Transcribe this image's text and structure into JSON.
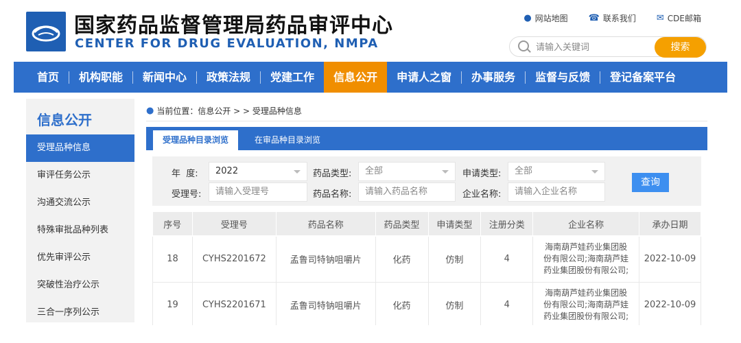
{
  "header": {
    "title_cn": "国家药品监督管理局药品审评中心",
    "title_en": "CENTER FOR DRUG EVALUATION, NMPA",
    "links": [
      {
        "icon": "location-icon",
        "label": "网站地图"
      },
      {
        "icon": "phone-icon",
        "label": "联系我们"
      },
      {
        "icon": "mail-icon",
        "label": "CDE邮箱"
      }
    ],
    "search_placeholder": "请输入关键词",
    "search_button": "搜索"
  },
  "nav": [
    "首页",
    "机构职能",
    "新闻中心",
    "政策法规",
    "党建工作",
    "信息公开",
    "申请人之窗",
    "办事服务",
    "监督与反馈",
    "登记备案平台"
  ],
  "nav_active": "信息公开",
  "sidebar": {
    "title": "信息公开",
    "items": [
      "受理品种信息",
      "审评任务公示",
      "沟通交流公示",
      "特殊审批品种列表",
      "优先审评公示",
      "突破性治疗公示",
      "三合一序列公示"
    ]
  },
  "breadcrumb": "当前位置：信息公开 > > 受理品种信息",
  "tabs": [
    "受理品种目录浏览",
    "在审品种目录浏览"
  ],
  "filters": {
    "year_label": "年  度:",
    "year_value": "2022",
    "drug_type_label": "药品类型:",
    "drug_type_value": "全部",
    "apply_type_label": "申请类型:",
    "apply_type_value": "全部",
    "accept_no_label": "受理号:",
    "accept_no_placeholder": "请输入受理号",
    "drug_name_label": "药品名称:",
    "drug_name_placeholder": "请输入药品名称",
    "company_label": "企业名称:",
    "company_placeholder": "请输入企业名称",
    "query_button": "查询"
  },
  "table": {
    "columns": [
      "序号",
      "受理号",
      "药品名称",
      "药品类型",
      "申请类型",
      "注册分类",
      "企业名称",
      "承办日期"
    ],
    "rows": [
      {
        "no": "18",
        "accept_no": "CYHS2201672",
        "drug": "孟鲁司特钠咀嚼片",
        "type": "化药",
        "apply": "仿制",
        "cls": "4",
        "company_l1": "海南葫芦娃药业集团股",
        "company_l2": "份有限公司;海南葫芦娃",
        "company_l3": "药业集团股份有限公司;",
        "date": "2022-10-09"
      },
      {
        "no": "19",
        "accept_no": "CYHS2201671",
        "drug": "孟鲁司特钠咀嚼片",
        "type": "化药",
        "apply": "仿制",
        "cls": "4",
        "company_l1": "海南葫芦娃药业集团股",
        "company_l2": "份有限公司;海南葫芦娃",
        "company_l3": "药业集团股份有限公司;",
        "date": "2022-10-09"
      }
    ]
  },
  "colors": {
    "primary": "#2e6fcb",
    "accent": "#f08e00",
    "search_button": "#f5a000"
  }
}
